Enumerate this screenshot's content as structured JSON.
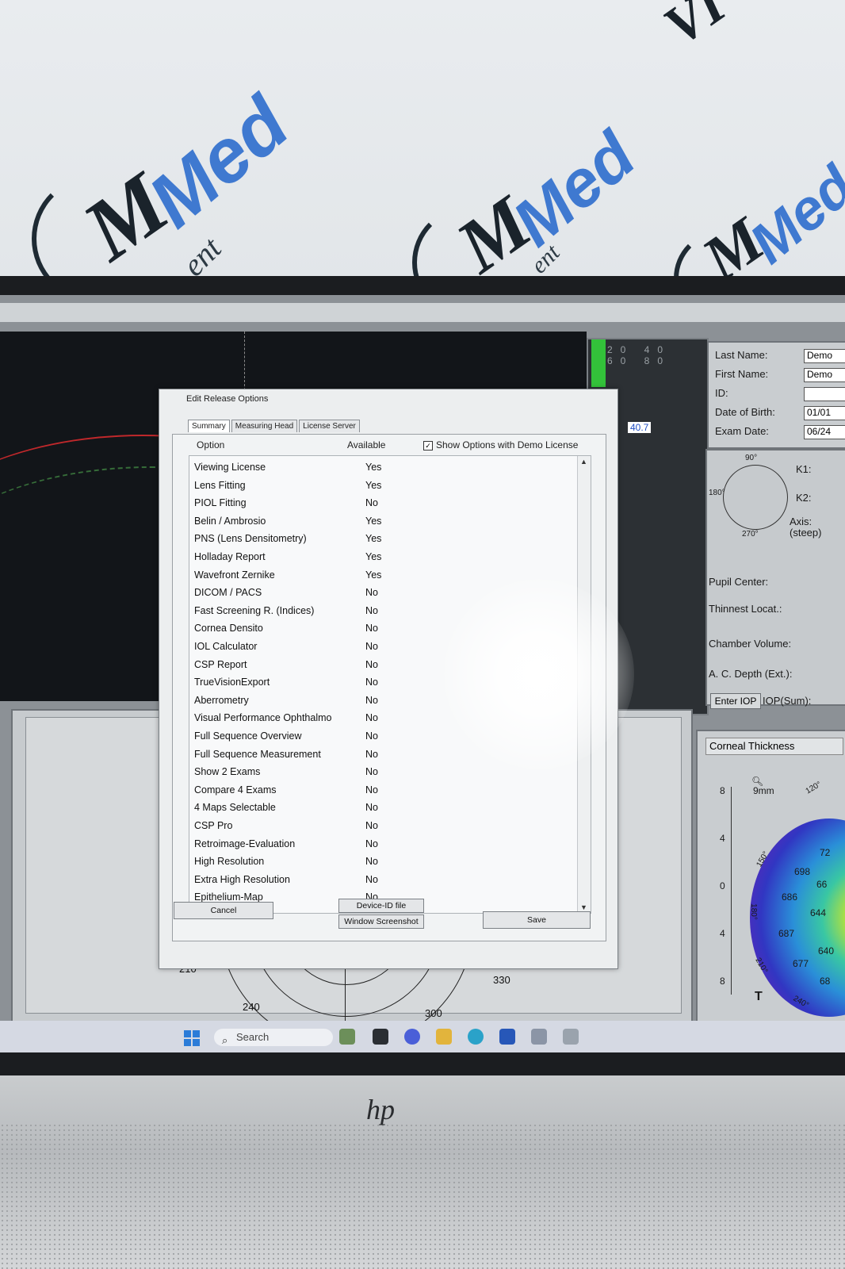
{
  "dialog": {
    "title": "Edit Release Options",
    "tabs": [
      "Summary",
      "Measuring Head",
      "License Server"
    ],
    "columns": {
      "option": "Option",
      "available": "Available"
    },
    "show_demo_label": "Show Options with Demo License",
    "show_demo_checked": true,
    "options": [
      {
        "name": "Viewing License",
        "available": "Yes"
      },
      {
        "name": "Lens Fitting",
        "available": "Yes"
      },
      {
        "name": "PIOL Fitting",
        "available": "No"
      },
      {
        "name": "Belin / Ambrosio",
        "available": "Yes"
      },
      {
        "name": "PNS (Lens Densitometry)",
        "available": "Yes"
      },
      {
        "name": "Holladay Report",
        "available": "Yes"
      },
      {
        "name": "Wavefront Zernike",
        "available": "Yes"
      },
      {
        "name": "DICOM / PACS",
        "available": "No"
      },
      {
        "name": "Fast Screening R. (Indices)",
        "available": "No"
      },
      {
        "name": "Cornea Densito",
        "available": "No"
      },
      {
        "name": "IOL Calculator",
        "available": "No"
      },
      {
        "name": "CSP Report",
        "available": "No"
      },
      {
        "name": "TrueVisionExport",
        "available": "No"
      },
      {
        "name": "Aberrometry",
        "available": "No"
      },
      {
        "name": "Visual Performance Ophthalmo",
        "available": "No"
      },
      {
        "name": "Full Sequence Overview",
        "available": "No"
      },
      {
        "name": "Full Sequence Measurement",
        "available": "No"
      },
      {
        "name": "Show 2 Exams",
        "available": "No"
      },
      {
        "name": "Compare 4 Exams",
        "available": "No"
      },
      {
        "name": "4 Maps Selectable",
        "available": "No"
      },
      {
        "name": "CSP Pro",
        "available": "No"
      },
      {
        "name": "Retroimage-Evaluation",
        "available": "No"
      },
      {
        "name": "High Resolution",
        "available": "No"
      },
      {
        "name": "Extra High Resolution",
        "available": "No"
      },
      {
        "name": "Epithelium-Map",
        "available": "No"
      }
    ],
    "buttons": {
      "cancel": "Cancel",
      "device_id": "Device-ID file",
      "window_screenshot": "Window Screenshot",
      "save": "Save"
    }
  },
  "patient": {
    "last_name_label": "Last Name:",
    "last_name_value": "Demo",
    "first_name_label": "First Name:",
    "first_name_value": "Demo",
    "id_label": "ID:",
    "id_value": "",
    "dob_label": "Date of Birth:",
    "dob_value": "01/01",
    "exam_date_label": "Exam Date:",
    "exam_date_value": "06/24"
  },
  "keratometry": {
    "k1_label": "K1:",
    "k2_label": "K2:",
    "axis_label": "Axis:",
    "axis_sub": "(steep)",
    "deg_90": "90°",
    "deg_180": "180°",
    "deg_270": "270°"
  },
  "measures": {
    "pupil_center": "Pupil Center:",
    "thinnest_locat": "Thinnest Locat.:",
    "chamber_volume": "Chamber Volume:",
    "ac_depth": "A. C. Depth (Ext.):",
    "enter_iop": "Enter IOP",
    "iop_sum": "IOP(Sum):"
  },
  "graph": {
    "ticks": "20 40 60 80",
    "value": "40.7"
  },
  "corneal_thickness": {
    "title": "Corneal Thickness",
    "zoom": "9mm",
    "axis_ticks": [
      "8",
      "4",
      "0",
      "4",
      "8"
    ],
    "bottom_ticks": [
      "8",
      "4"
    ],
    "t_label": "T",
    "angles": [
      "120°",
      "150°",
      "180°",
      "210°",
      "240°"
    ],
    "values": [
      "698",
      "686",
      "644",
      "687",
      "677",
      "72",
      "66",
      "640",
      "68"
    ]
  },
  "polar_plot": {
    "labels": [
      "210",
      "240",
      "300",
      "330"
    ]
  },
  "taskbar": {
    "search_placeholder": "Search"
  },
  "branding": {
    "wall_logo_text": "Med",
    "wall_logo_fragment": "ent",
    "monitor_brand": "hp"
  },
  "colors": {
    "dialog_bg": "#eceeef",
    "accent_blue": "#2b7cd8",
    "graph_green": "#33c23a",
    "logo_blue": "#3f79d0"
  }
}
